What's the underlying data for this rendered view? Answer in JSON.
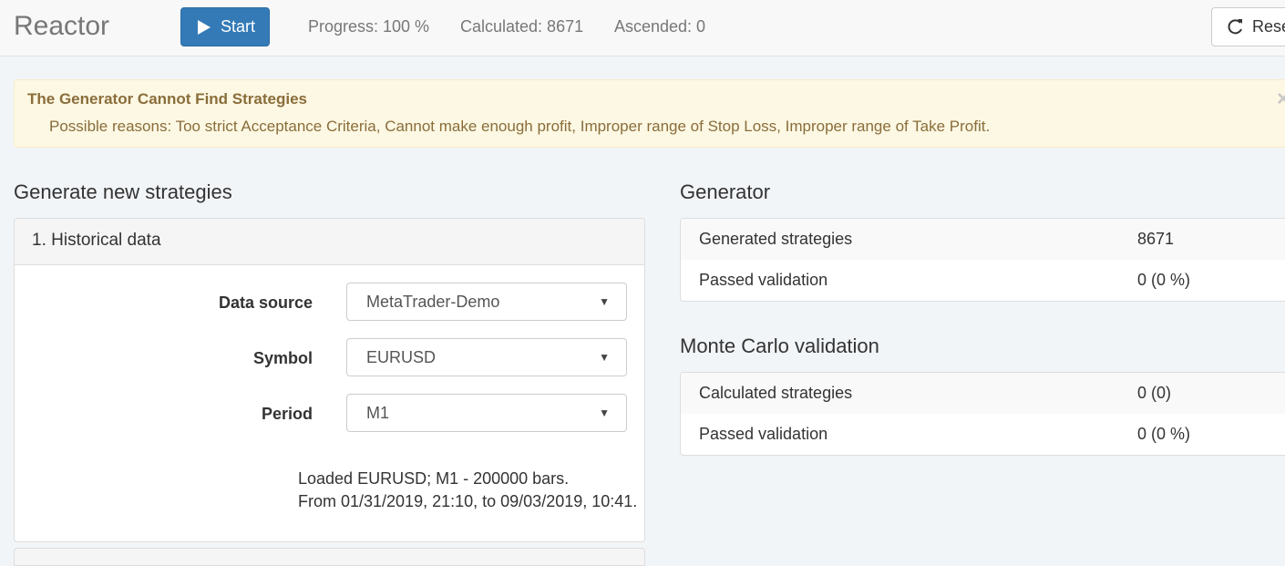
{
  "app": {
    "title": "Reactor"
  },
  "toolbar": {
    "start_label": "Start",
    "progress": "Progress: 100 %",
    "calculated": "Calculated: 8671",
    "ascended": "Ascended: 0",
    "reset_label": "Reset"
  },
  "alert": {
    "title": "The Generator Cannot Find Strategies",
    "text": "Possible reasons: Too strict Acceptance Criteria, Cannot make enough profit, Improper range of Stop Loss, Improper range of Take Profit.",
    "close": "×"
  },
  "left": {
    "title": "Generate new strategies",
    "panel_title": "1. Historical data",
    "fields": [
      {
        "label": "Data source",
        "value": "MetaTrader-Demo"
      },
      {
        "label": "Symbol",
        "value": "EURUSD"
      },
      {
        "label": "Period",
        "value": "M1"
      }
    ],
    "loaded_line1": "Loaded EURUSD; M1 - 200000 bars.",
    "loaded_line2": "From 01/31/2019, 21:10, to 09/03/2019, 10:41."
  },
  "generator": {
    "title": "Generator",
    "rows": [
      {
        "label": "Generated strategies",
        "value": "8671"
      },
      {
        "label": "Passed validation",
        "value": "0 (0 %)"
      }
    ]
  },
  "monte_carlo": {
    "title": "Monte Carlo validation",
    "rows": [
      {
        "label": "Calculated strategies",
        "value": "0 (0)"
      },
      {
        "label": "Passed validation",
        "value": "0 (0 %)"
      }
    ]
  },
  "colors": {
    "primary": "#337ab7",
    "warning_bg": "#fcf8e3",
    "warning_text": "#8a6d3b"
  },
  "icons": {
    "start": "play-icon",
    "reset": "refresh-icon",
    "close": "close-icon",
    "dropdown": "caret-down-icon"
  }
}
